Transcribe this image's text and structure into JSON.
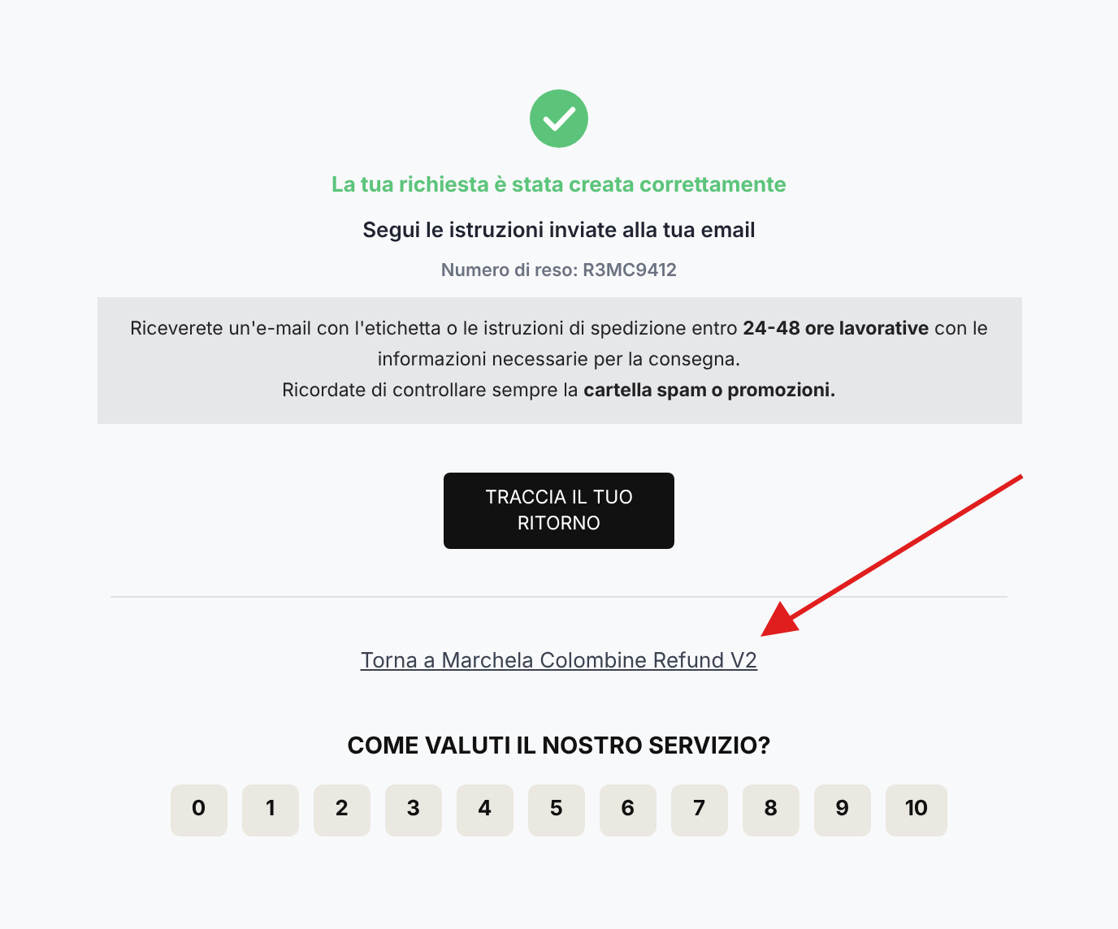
{
  "status": {
    "title": "La tua richiesta è stata creata correttamente",
    "subtitle": "Segui le istruzioni inviate alla tua email",
    "return_number": "Numero di reso: R3MC9412"
  },
  "notice": [
    "Riceverete un'e-mail con l'etichetta o le istruzioni di spedizione entro **24-48 ore lavorative** con le informazioni necessarie per la consegna.",
    "Ricordate di controllare sempre la **cartella spam o promozioni.**"
  ],
  "track_button": "TRACCIA IL TUO RITORNO",
  "back_link": "Torna a Marchela Colombine Refund V2",
  "rating": {
    "question": "COME VALUTI IL NOSTRO SERVIZIO?",
    "options": [
      "0",
      "1",
      "2",
      "3",
      "4",
      "5",
      "6",
      "7",
      "8",
      "9",
      "10"
    ]
  }
}
